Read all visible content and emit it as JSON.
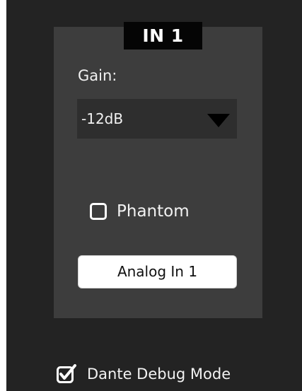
{
  "channel": {
    "title": "IN 1",
    "gain_label": "Gain:",
    "gain_value": "-12dB",
    "phantom_label": "Phantom",
    "phantom_checked": false,
    "name_value": "Analog In 1"
  },
  "footer": {
    "debug_label": "Dante Debug Mode",
    "debug_checked": true
  },
  "icons": {
    "gain_dropdown": "chevron-down-icon",
    "phantom_checkbox": "checkbox-empty-icon",
    "debug_checkbox": "checkbox-checked-icon"
  },
  "colors": {
    "window_bg": "#232323",
    "panel_bg": "#3d3d3d",
    "title_bg": "#050505",
    "dropdown_bg": "#2e2e2e",
    "text": "#f2f2f2"
  }
}
